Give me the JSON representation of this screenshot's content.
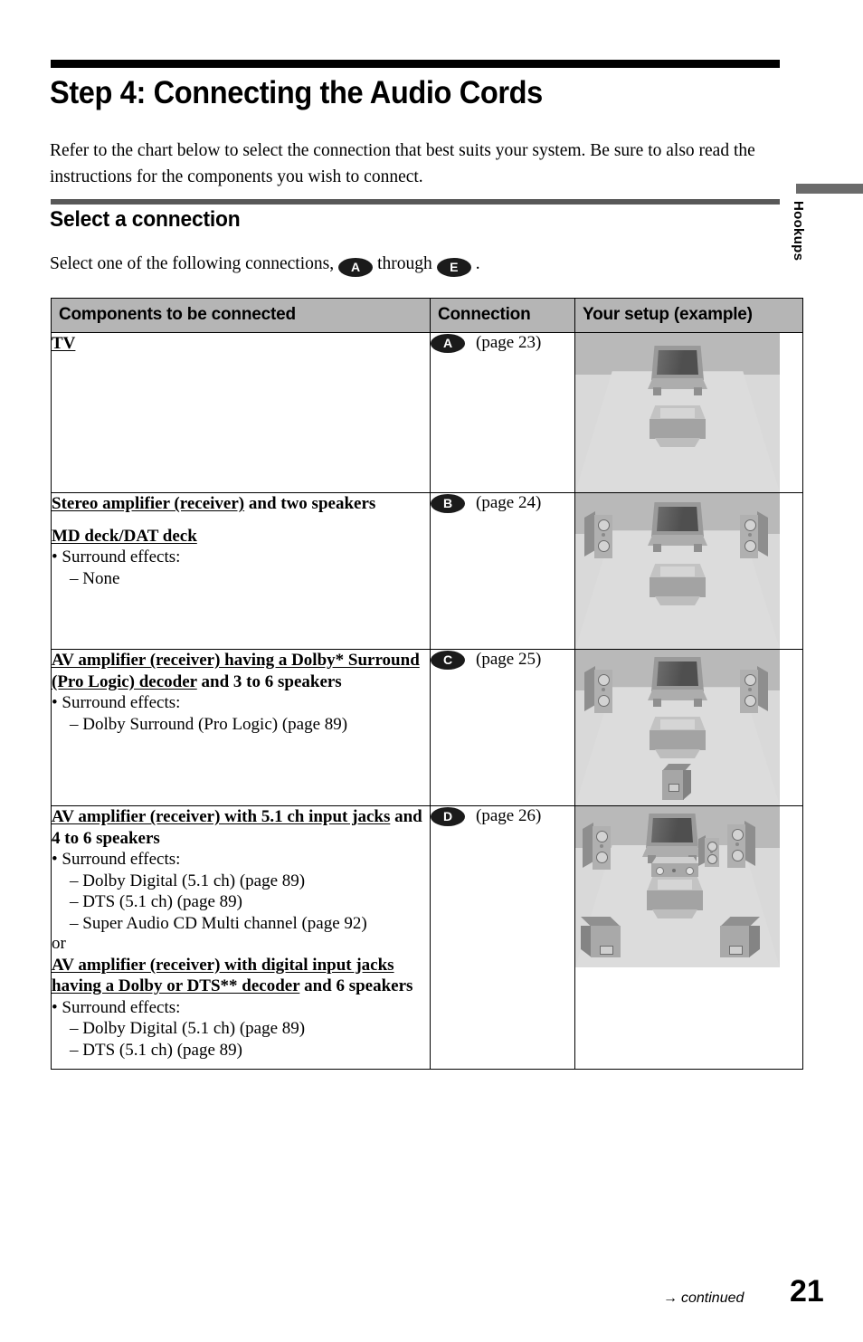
{
  "document": {
    "title": "Step 4: Connecting the Audio Cords",
    "intro": "Refer to the chart below to select the connection that best suits your system. Be sure to also read the instructions for the components you wish to connect.",
    "side_tab": "Hookups",
    "page_number": "21",
    "continued_label": "continued",
    "continued_arrow": "→"
  },
  "section": {
    "heading": "Select a connection",
    "lead_before": "Select one of the following connections,",
    "lead_badge_first": "A",
    "lead_middle": "through",
    "lead_badge_last": "E",
    "lead_after": "."
  },
  "table": {
    "headers": {
      "components": "Components to be connected",
      "connection": "Connection",
      "setup": "Your setup (example)"
    },
    "rows": [
      {
        "badge": "A",
        "page_ref": "(page 23)",
        "blocks": [
          {
            "type": "heading",
            "underlined": "TV",
            "plain": ""
          }
        ]
      },
      {
        "badge": "B",
        "page_ref": "(page 24)",
        "blocks": [
          {
            "type": "heading",
            "underlined": "Stereo amplifier (receiver)",
            "plain": " and two speakers"
          },
          {
            "type": "gap"
          },
          {
            "type": "heading",
            "underlined": "MD deck/DAT deck",
            "plain": ""
          },
          {
            "type": "bullet",
            "text": "• Surround effects:"
          },
          {
            "type": "subbullet",
            "text": "– None"
          }
        ]
      },
      {
        "badge": "C",
        "page_ref": "(page 25)",
        "blocks": [
          {
            "type": "heading",
            "underlined": "AV amplifier (receiver) having a Dolby* Surround (Pro Logic) decoder",
            "plain": " and 3 to 6 speakers"
          },
          {
            "type": "bullet",
            "text": "• Surround effects:"
          },
          {
            "type": "subbullet",
            "text": "– Dolby Surround (Pro Logic) (page 89)"
          }
        ]
      },
      {
        "badge": "D",
        "page_ref": "(page 26)",
        "blocks": [
          {
            "type": "heading",
            "underlined": "AV amplifier (receiver) with 5.1 ch input jacks",
            "plain": " and 4 to 6 speakers"
          },
          {
            "type": "bullet",
            "text": "• Surround effects:"
          },
          {
            "type": "subbullet",
            "text": "– Dolby Digital (5.1 ch) (page 89)"
          },
          {
            "type": "subbullet",
            "text": "– DTS (5.1 ch) (page 89)"
          },
          {
            "type": "subbullet",
            "text": "– Super Audio CD Multi channel (page 92)"
          },
          {
            "type": "plain",
            "text": "or"
          },
          {
            "type": "heading",
            "underlined": "AV amplifier (receiver) with digital input jacks having a Dolby or DTS** decoder",
            "plain": " and 6 speakers"
          },
          {
            "type": "bullet",
            "text": "• Surround effects:"
          },
          {
            "type": "subbullet",
            "text": "– Dolby Digital (5.1 ch) (page 89)"
          },
          {
            "type": "subbullet",
            "text": "– DTS (5.1 ch) (page 89)"
          }
        ]
      }
    ]
  },
  "illustrations": {
    "a": {
      "components": [
        "tv",
        "disc-player"
      ]
    },
    "b": {
      "components": [
        "tv",
        "disc-player",
        "front-left-speaker",
        "front-right-speaker"
      ]
    },
    "c": {
      "components": [
        "tv",
        "disc-player",
        "front-left-speaker",
        "front-right-speaker",
        "rear-speaker"
      ]
    },
    "d": {
      "components": [
        "tv",
        "av-amplifier",
        "disc-player",
        "front-left-speaker",
        "front-right-speaker",
        "center-speaker",
        "surround-left-speaker",
        "surround-right-speaker"
      ]
    }
  },
  "colors": {
    "rule_black": "#000000",
    "rule_gray": "#585858",
    "header_fill": "#b5b5b5",
    "badge_fill": "#1b1b1b",
    "room_wall": "#b9b9b9",
    "room_floor": "#dcdcdc"
  }
}
